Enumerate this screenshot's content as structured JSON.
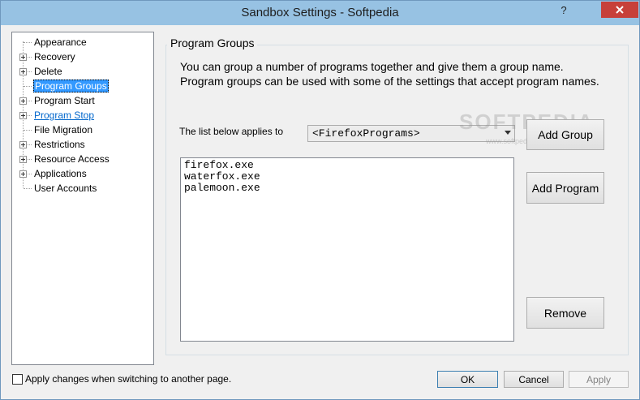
{
  "window": {
    "title": "Sandbox Settings - Softpedia",
    "help_glyph": "?",
    "close_glyph": "x"
  },
  "tree": {
    "items": [
      {
        "label": "Appearance",
        "expandable": false,
        "state": "normal"
      },
      {
        "label": "Recovery",
        "expandable": true,
        "state": "normal"
      },
      {
        "label": "Delete",
        "expandable": true,
        "state": "normal"
      },
      {
        "label": "Program Groups",
        "expandable": false,
        "state": "selected"
      },
      {
        "label": "Program Start",
        "expandable": true,
        "state": "normal"
      },
      {
        "label": "Program Stop",
        "expandable": true,
        "state": "link"
      },
      {
        "label": "File Migration",
        "expandable": false,
        "state": "normal"
      },
      {
        "label": "Restrictions",
        "expandable": true,
        "state": "normal"
      },
      {
        "label": "Resource Access",
        "expandable": true,
        "state": "normal"
      },
      {
        "label": "Applications",
        "expandable": true,
        "state": "normal"
      },
      {
        "label": "User Accounts",
        "expandable": false,
        "state": "normal"
      }
    ]
  },
  "main": {
    "group_caption": "Program Groups",
    "description": "You can group a number of programs together and give them a group name.  Program groups can be used with some of the settings that accept program names.",
    "applies_label": "The list below applies to",
    "group_select": "<FirefoxPrograms>",
    "programs": [
      "firefox.exe",
      "waterfox.exe",
      "palemoon.exe"
    ],
    "add_group_label": "Add Group",
    "add_program_label": "Add Program",
    "remove_label": "Remove"
  },
  "watermark": {
    "text": "SOFTPEDIA",
    "sub": "www.softpedia.com"
  },
  "footer": {
    "checkbox_label": "Apply changes when switching to another page.",
    "checkbox_checked": false,
    "ok_label": "OK",
    "cancel_label": "Cancel",
    "apply_label": "Apply"
  },
  "colors": {
    "titlebar": "#97c2e3",
    "selection": "#3399ff",
    "link": "#0066cc",
    "close": "#c7403a"
  }
}
